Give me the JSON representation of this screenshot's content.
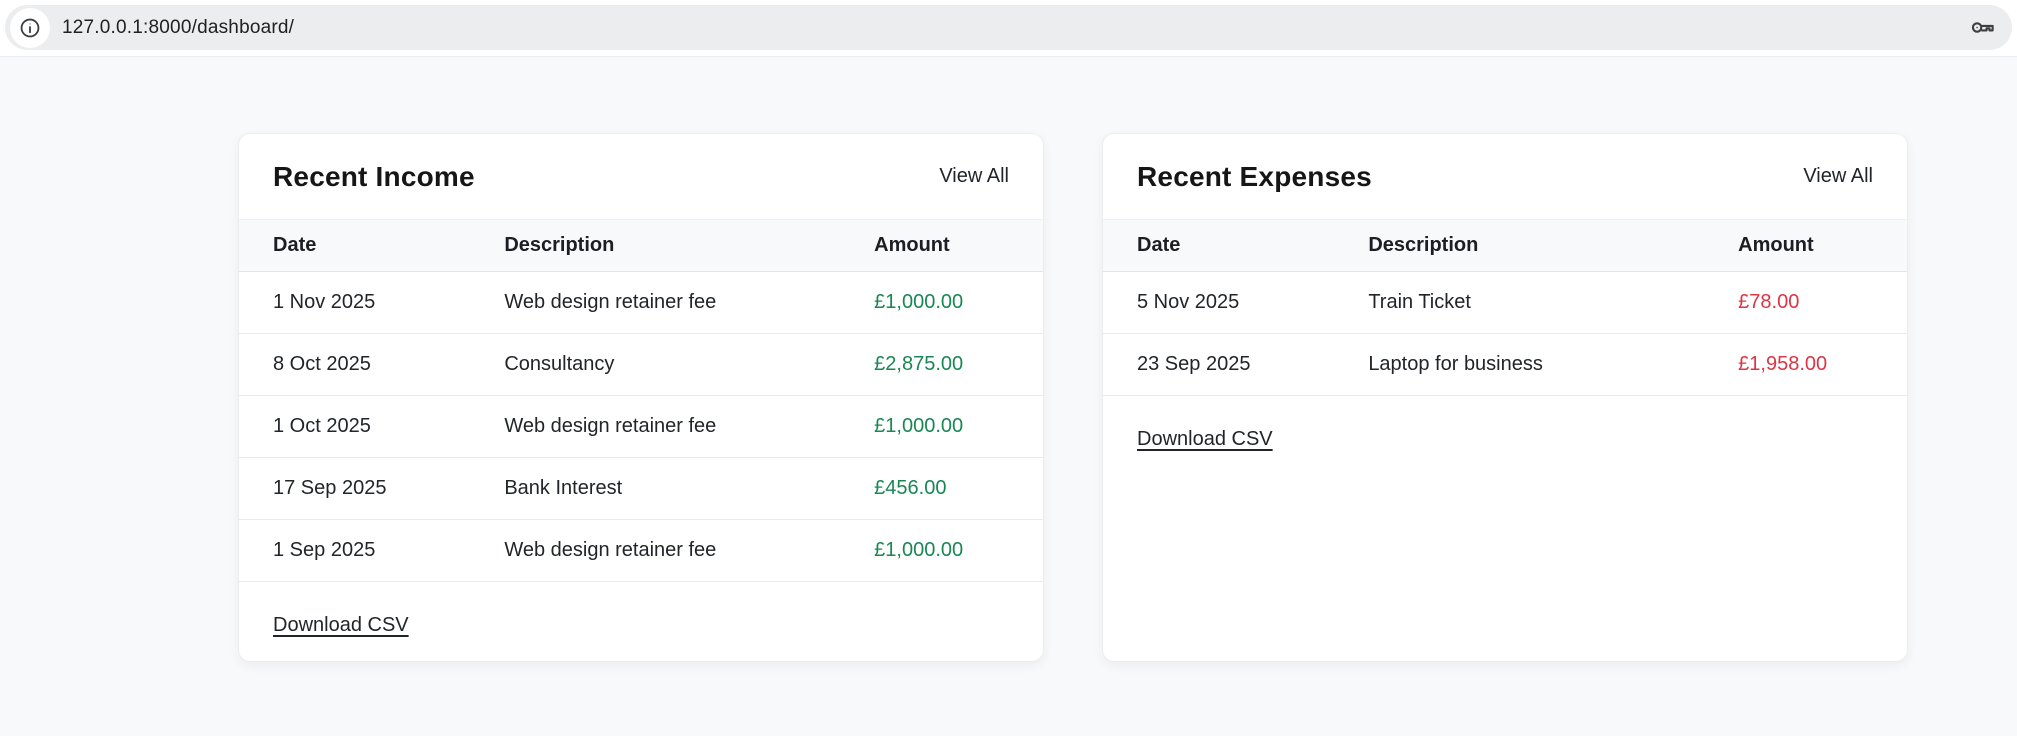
{
  "browser": {
    "url": "127.0.0.1:8000/dashboard/",
    "icons": {
      "site_info": "info-icon",
      "password_key": "key-icon"
    }
  },
  "colors": {
    "income_amount": "#198754",
    "expense_amount": "#dc3545",
    "page_bg": "#f8f9fa",
    "icon_gray": "#3c4043"
  },
  "income_card": {
    "title": "Recent Income",
    "view_all_label": "View All",
    "download_csv_label": "Download CSV",
    "columns": [
      "Date",
      "Description",
      "Amount"
    ],
    "rows": [
      {
        "date": "1 Nov 2025",
        "description": "Web design retainer fee",
        "amount": "£1,000.00"
      },
      {
        "date": "8 Oct 2025",
        "description": "Consultancy",
        "amount": "£2,875.00"
      },
      {
        "date": "1 Oct 2025",
        "description": "Web design retainer fee",
        "amount": "£1,000.00"
      },
      {
        "date": "17 Sep 2025",
        "description": "Bank Interest",
        "amount": "£456.00"
      },
      {
        "date": "1 Sep 2025",
        "description": "Web design retainer fee",
        "amount": "£1,000.00"
      }
    ]
  },
  "expenses_card": {
    "title": "Recent Expenses",
    "view_all_label": "View All",
    "download_csv_label": "Download CSV",
    "columns": [
      "Date",
      "Description",
      "Amount"
    ],
    "rows": [
      {
        "date": "5 Nov 2025",
        "description": "Train Ticket",
        "amount": "£78.00"
      },
      {
        "date": "23 Sep 2025",
        "description": "Laptop for business",
        "amount": "£1,958.00"
      }
    ]
  }
}
